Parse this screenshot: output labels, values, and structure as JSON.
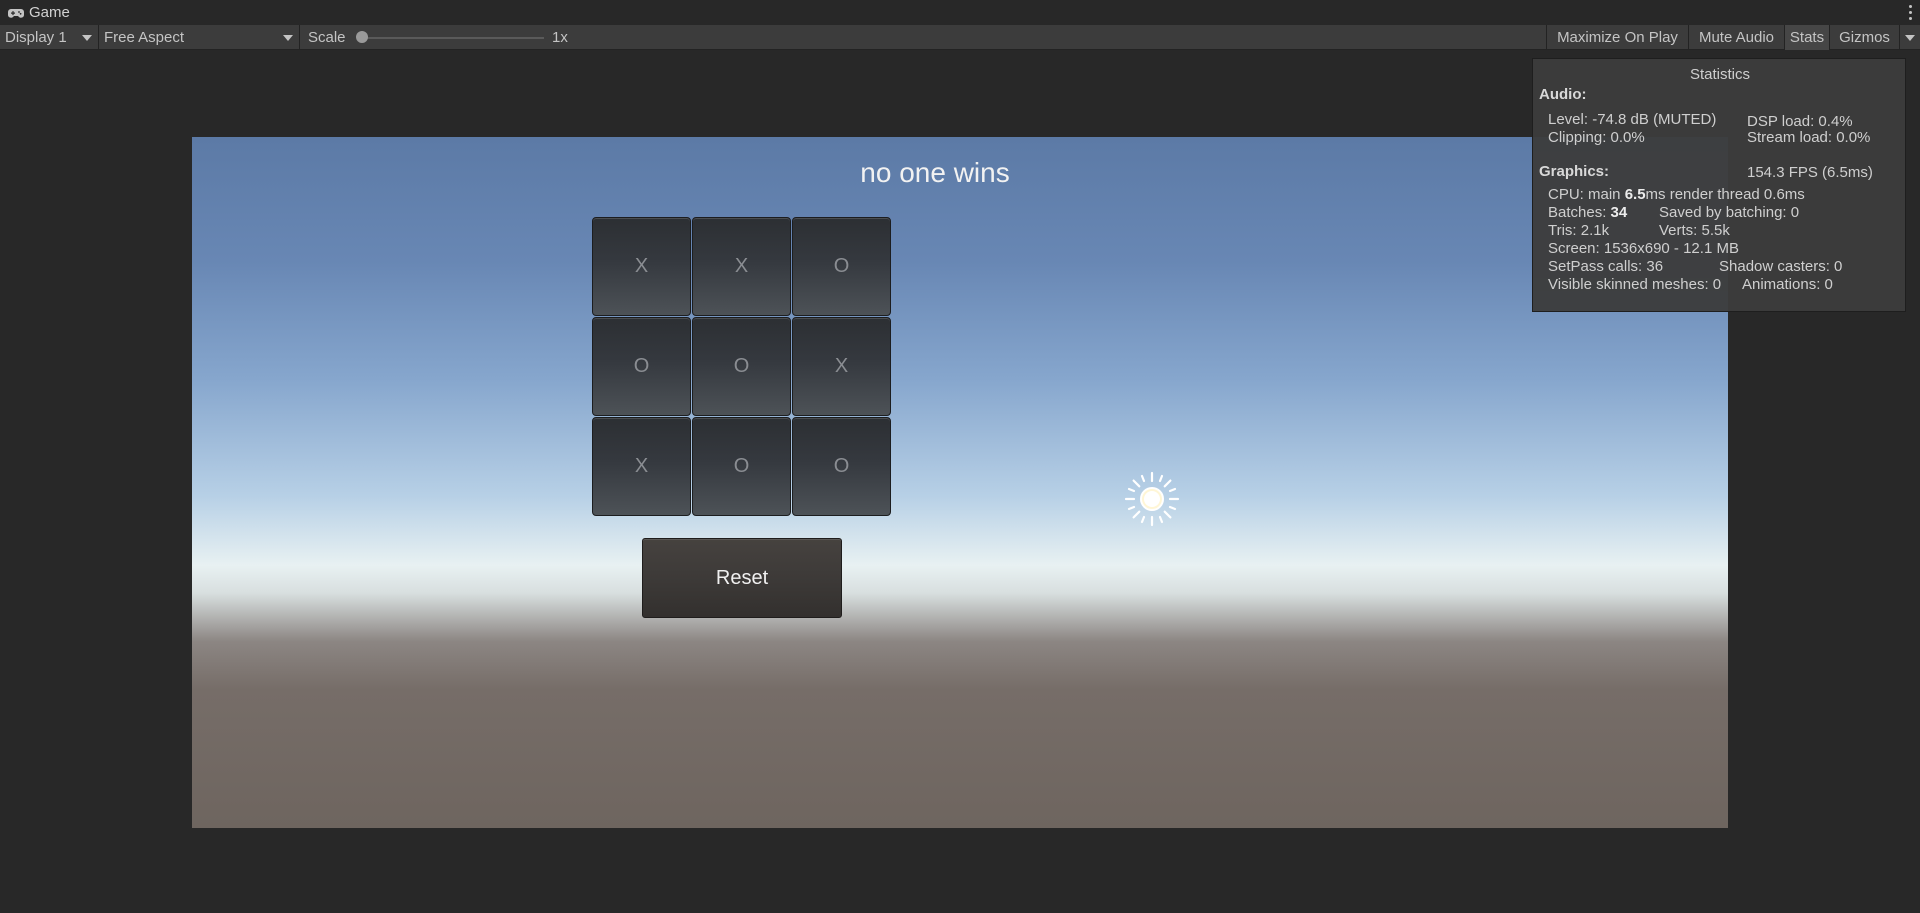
{
  "tab": {
    "title": "Game",
    "icon": "gamepad-icon"
  },
  "toolbar": {
    "display": "Display 1",
    "aspect": "Free Aspect",
    "scale_label": "Scale",
    "scale_value": "1x",
    "scale_slider_fraction": 0.0,
    "buttons": {
      "maximize": "Maximize On Play",
      "mute": "Mute Audio",
      "stats": "Stats",
      "gizmos": "Gizmos"
    }
  },
  "game": {
    "status_text": "no one wins",
    "board": [
      "X",
      "X",
      "O",
      "O",
      "O",
      "X",
      "X",
      "O",
      "O"
    ],
    "reset_label": "Reset"
  },
  "stats": {
    "title": "Statistics",
    "audio_header": "Audio:",
    "level": "Level: -74.8 dB (MUTED)",
    "clipping": "Clipping: 0.0%",
    "dsp_load": "DSP load: 0.4%",
    "stream_load": "Stream load: 0.0%",
    "graphics_header": "Graphics:",
    "fps": "154.3 FPS (6.5ms)",
    "cpu_prefix": "CPU: main ",
    "cpu_main": "6.5",
    "cpu_suffix": "ms  render thread 0.6ms",
    "batches_prefix": "Batches: ",
    "batches": "34",
    "saved_batching": "Saved by batching: 0",
    "tris": "Tris: 2.1k",
    "verts": "Verts: 5.5k",
    "screen": "Screen: 1536x690 - 12.1 MB",
    "setpass": "SetPass calls: 36",
    "shadow_casters": "Shadow casters: 0",
    "skinned": "Visible skinned meshes: 0",
    "animations": "Animations: 0"
  },
  "colors": {
    "editor_bg": "#282828",
    "toolbar_bg": "#3c3c3c",
    "cell_bg": "#35393f",
    "text_light": "#f2f2f2"
  }
}
